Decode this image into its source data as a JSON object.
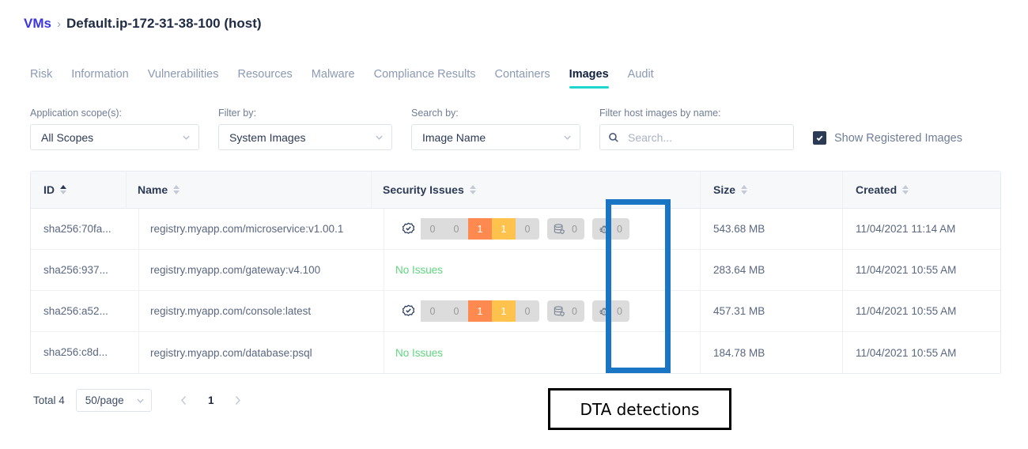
{
  "breadcrumb": {
    "root_label": "VMs",
    "separator": "›",
    "current_label": "Default.ip-172-31-38-100 (host)"
  },
  "tabs": [
    {
      "label": "Risk",
      "active": false
    },
    {
      "label": "Information",
      "active": false
    },
    {
      "label": "Vulnerabilities",
      "active": false
    },
    {
      "label": "Resources",
      "active": false
    },
    {
      "label": "Malware",
      "active": false
    },
    {
      "label": "Compliance Results",
      "active": false
    },
    {
      "label": "Containers",
      "active": false
    },
    {
      "label": "Images",
      "active": true
    },
    {
      "label": "Audit",
      "active": false
    }
  ],
  "filters": {
    "scope": {
      "label": "Application scope(s):",
      "value": "All Scopes"
    },
    "filter_by": {
      "label": "Filter by:",
      "value": "System Images"
    },
    "search_by": {
      "label": "Search by:",
      "value": "Image Name"
    },
    "host_search": {
      "label": "Filter host images by name:",
      "value": "",
      "placeholder": "Search...",
      "icon": "search-icon"
    },
    "show_registered": {
      "label": "Show Registered Images",
      "checked": true
    }
  },
  "table": {
    "columns": [
      {
        "label": "ID",
        "sorted": true
      },
      {
        "label": "Name",
        "sorted": false
      },
      {
        "label": "Security Issues",
        "sorted": false
      },
      {
        "label": "Size",
        "sorted": false
      },
      {
        "label": "Created",
        "sorted": false
      }
    ],
    "rows": [
      {
        "id": "sha256:70fa...",
        "name": "registry.myapp.com/microservice:v1.00.1",
        "has_issues": true,
        "no_issues_label": "No Issues",
        "severities": [
          "0",
          "0",
          "1",
          "1",
          "0"
        ],
        "malware_count": "0",
        "dta_count": "0",
        "size": "543.68 MB",
        "created": "11/04/2021 11:14 AM"
      },
      {
        "id": "sha256:937...",
        "name": "registry.myapp.com/gateway:v4.100",
        "has_issues": false,
        "no_issues_label": "No Issues",
        "severities": [],
        "malware_count": "",
        "dta_count": "",
        "size": "283.64 MB",
        "created": "11/04/2021 10:55 AM"
      },
      {
        "id": "sha256:a52...",
        "name": "registry.myapp.com/console:latest",
        "has_issues": true,
        "no_issues_label": "No Issues",
        "severities": [
          "0",
          "0",
          "1",
          "1",
          "0"
        ],
        "malware_count": "0",
        "dta_count": "0",
        "size": "457.31 MB",
        "created": "11/04/2021 10:55 AM"
      },
      {
        "id": "sha256:c8d...",
        "name": "registry.myapp.com/database:psql",
        "has_issues": false,
        "no_issues_label": "No Issues",
        "severities": [],
        "malware_count": "",
        "dta_count": "",
        "size": "184.78 MB",
        "created": "11/04/2021 10:55 AM"
      }
    ]
  },
  "footer": {
    "total_label": "Total 4",
    "page_size": "50/page",
    "prev_icon": "chevron-left-icon",
    "next_icon": "chevron-right-icon",
    "current_page": "1"
  },
  "annotation": {
    "callout_text": "DTA detections",
    "highlight_color": "#1a75c4"
  },
  "colors": {
    "link": "#3a36e0",
    "tab_active_underline": "#1fd6cf",
    "severity_critical": "#ff8a4f",
    "severity_high": "#ffc34d",
    "severity_none": "#dcdcdc",
    "no_issues_green": "#5fd67e",
    "checkbox": "#2b3a55"
  }
}
